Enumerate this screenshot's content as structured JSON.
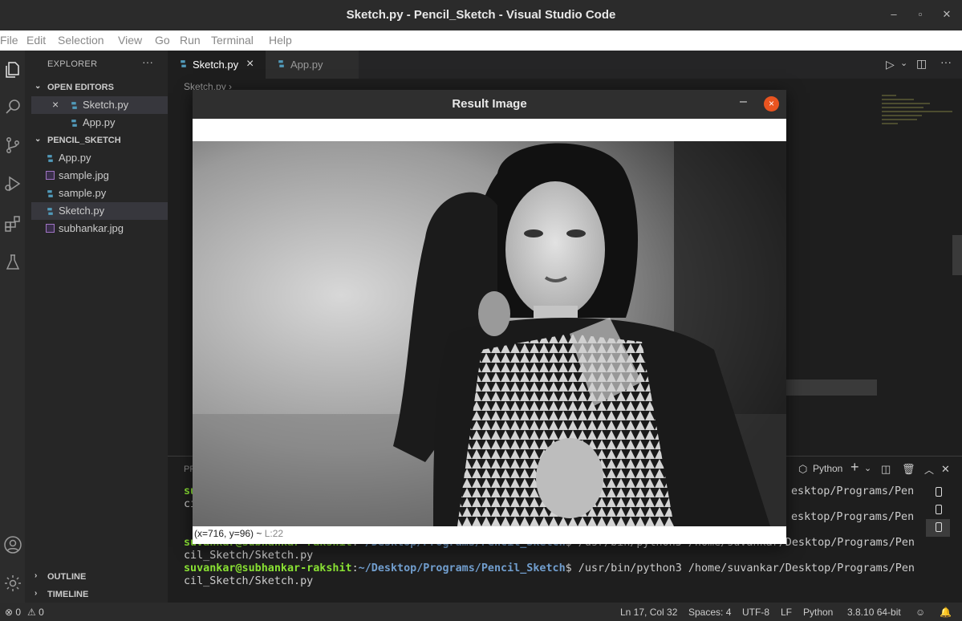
{
  "window": {
    "title": "Sketch.py - Pencil_Sketch - Visual Studio Code"
  },
  "menu": [
    "File",
    "Edit",
    "Selection",
    "View",
    "Go",
    "Run",
    "Terminal",
    "Help"
  ],
  "activity_bar": [
    "files-icon",
    "search-icon",
    "source-control-icon",
    "run-debug-icon",
    "extensions-icon",
    "testing-icon",
    "account-icon",
    "settings-gear-icon"
  ],
  "sidebar": {
    "header": "EXPLORER",
    "more": "···",
    "open_editors_label": "OPEN EDITORS",
    "open_editors": [
      {
        "label": "Sketch.py"
      },
      {
        "label": "App.py"
      }
    ],
    "folder_label": "PENCIL_SKETCH",
    "files": [
      {
        "label": "App.py",
        "type": "py"
      },
      {
        "label": "sample.jpg",
        "type": "img"
      },
      {
        "label": "sample.py",
        "type": "py"
      },
      {
        "label": "Sketch.py",
        "type": "py"
      },
      {
        "label": "subhankar.jpg",
        "type": "img"
      }
    ],
    "outline_label": "OUTLINE",
    "timeline_label": "TIMELINE"
  },
  "tabs": [
    {
      "label": "Sketch.py",
      "active": true,
      "close": "×"
    },
    {
      "label": "App.py",
      "active": false
    }
  ],
  "breadcrumb": "Sketch.py",
  "panel": {
    "title_stub": "PR",
    "shell_label": "Python",
    "plus": "+",
    "terminal": {
      "line1_tail": "esktop/Programs/Pen",
      "line2_head": "ci",
      "line3_tail": "esktop/Programs/Pen",
      "line5_head": "cil_Sketch/Sketch.py",
      "line6_head": "cil_Sketch/Sketch.py",
      "user": "suvankar@subhankar-rakshit",
      "colon": ":",
      "path": "~/Desktop/Programs/Pencil_Sketch",
      "command": "$ /usr/bin/python3 /home/suvankar/Desktop/Programs/Pen"
    }
  },
  "dialog": {
    "title": "Result Image",
    "minimize": "–",
    "close": "×",
    "status_coords": "(x=716, y=96) ~",
    "status_level": "L:22"
  },
  "statusbar": {
    "errors": "⊗ 0",
    "warnings": "⚠ 0",
    "position": "Ln 17, Col 32",
    "spaces": "Spaces: 4",
    "encoding": "UTF-8",
    "eol": "LF",
    "language": "Python",
    "interpreter": "3.8.10 64-bit"
  },
  "colors": {
    "terminal_user": "#8ae234",
    "terminal_path": "#729fcf",
    "dialog_close": "#e95420",
    "python_icon": "#519aba"
  }
}
